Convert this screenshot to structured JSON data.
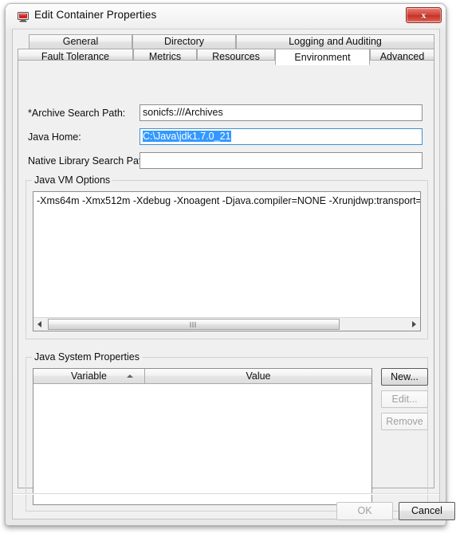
{
  "window": {
    "title": "Edit Container Properties",
    "icon": "container-monitor-icon",
    "close_label": "x"
  },
  "tabs": {
    "row1": [
      {
        "label": "General",
        "selected": false
      },
      {
        "label": "Directory",
        "selected": false
      },
      {
        "label": "Logging and Auditing",
        "selected": false
      }
    ],
    "row2": [
      {
        "label": "Fault Tolerance",
        "selected": false
      },
      {
        "label": "Metrics",
        "selected": false
      },
      {
        "label": "Resources",
        "selected": false
      },
      {
        "label": "Environment",
        "selected": true
      },
      {
        "label": "Advanced",
        "selected": false
      }
    ]
  },
  "form": {
    "archive_search_path": {
      "label": "*Archive Search Path:",
      "value": "sonicfs:///Archives",
      "placeholder": ""
    },
    "java_home": {
      "label": "Java Home:",
      "value": "C:\\Java\\jdk1.7.0_21",
      "placeholder": "",
      "selected": true
    },
    "native_library_search_path": {
      "label": "Native Library Search Path:",
      "value": "",
      "placeholder": ""
    }
  },
  "vm_options": {
    "group_title": "Java VM Options",
    "value": "-Xms64m -Xmx512m -Xdebug -Xnoagent -Djava.compiler=NONE -Xrunjdwp:transport=dt_socket,suspend",
    "scroll_left_icon": "scroll-left-arrow-icon",
    "scroll_right_icon": "scroll-right-arrow-icon"
  },
  "system_properties": {
    "group_title": "Java System Properties",
    "columns": [
      {
        "label": "Variable",
        "sorted": "asc"
      },
      {
        "label": "Value",
        "sorted": "none"
      }
    ],
    "rows": [],
    "buttons": [
      {
        "label": "New...",
        "enabled": true,
        "default": true
      },
      {
        "label": "Edit...",
        "enabled": false,
        "default": false
      },
      {
        "label": "Remove",
        "enabled": false,
        "default": false
      }
    ]
  },
  "footer": {
    "ok_label": "OK",
    "ok_enabled": false,
    "cancel_label": "Cancel",
    "cancel_enabled": true
  },
  "colors": {
    "dialog_bg": "#f0f0f0",
    "selection_blue": "#3399ff",
    "focus_border": "#3f8fd2",
    "close_red": "#cf4236"
  }
}
